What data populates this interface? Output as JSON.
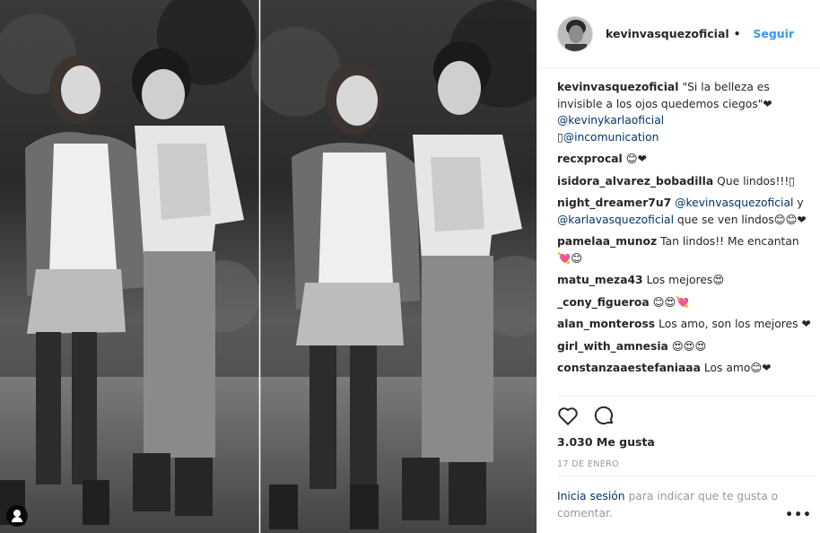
{
  "post": {
    "author": "kevinvasquezoficial",
    "separator": "•",
    "follow_label": "Seguir",
    "caption": {
      "user": "kevinvasquezoficial",
      "text": "\"Si la belleza es invisible a los ojos quedemos ciegos\"❤",
      "mention_1": "@kevinykarlaoficial",
      "prefix_2": "▯",
      "mention_2": "@incomunication"
    },
    "comments": [
      {
        "user": "recxprocal",
        "text": "😊❤"
      },
      {
        "user": "isidora_alvarez_bobadilla",
        "text": "Que lindos!!!▯"
      },
      {
        "user": "night_dreamer7u7",
        "mention_1": "@kevinvasquezoficial",
        "mid": " y ",
        "mention_2": "@karlavasquezoficial",
        "text": " que se ven lindos😊😊❤"
      },
      {
        "user": "pamelaa_munoz",
        "text": "Tan lindos!! Me encantan 💘😊"
      },
      {
        "user": "matu_meza43",
        "text": "Los mejores😍"
      },
      {
        "user": "_cony_figueroa",
        "text": "😊😍💘"
      },
      {
        "user": "alan_monteross",
        "text": "Los amo, son los mejores ❤"
      },
      {
        "user": "girl_with_amnesia",
        "text": "😍😍😍"
      },
      {
        "user": "constanzaaestefaniaaa",
        "text": "Los amo😊❤"
      }
    ],
    "likes": "3.030 Me gusta",
    "date": "17 DE ENERO",
    "login": {
      "link": "Inicia sesión",
      "text": " para indicar que te gusta o comentar."
    },
    "more_options": "•••",
    "icons": {
      "like": "heart-icon",
      "comment": "comment-icon",
      "tag": "user-tag-icon",
      "more": "more-options-icon"
    },
    "colors": {
      "link": "#003569",
      "follow": "#3897f0",
      "muted": "#999999",
      "text": "#262626"
    }
  }
}
